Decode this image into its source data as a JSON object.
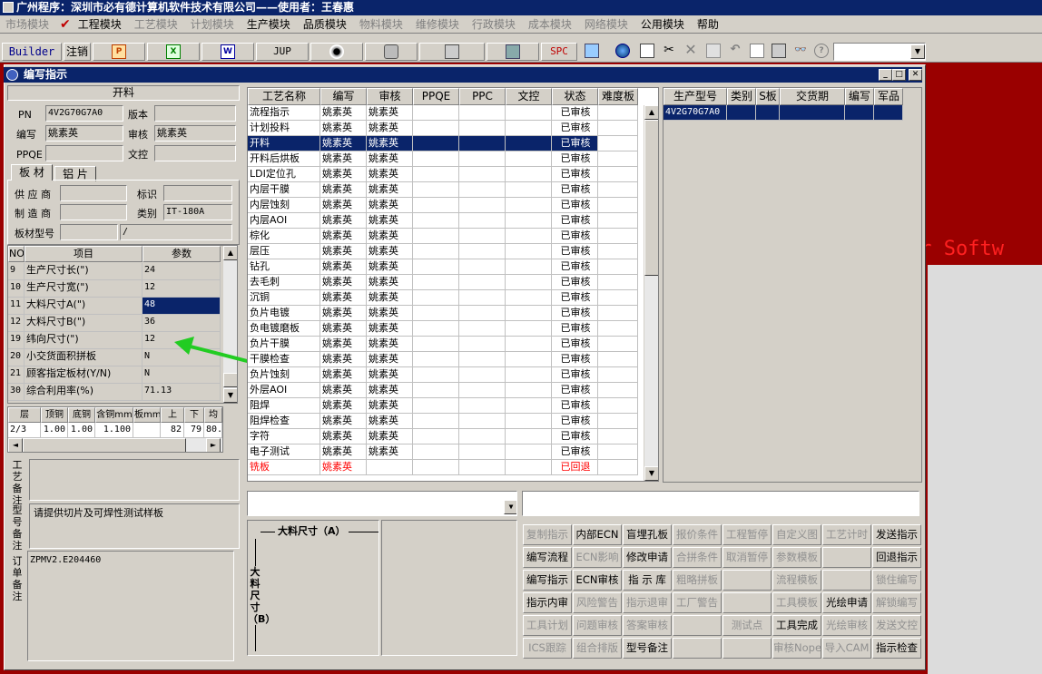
{
  "app": {
    "title": "广州程序：深圳市必有德计算机软件技术有限公司——使用者：王春惠"
  },
  "menu": [
    {
      "label": "市场模块",
      "active": false
    },
    {
      "label": "工程模块",
      "active": true
    },
    {
      "label": "工艺模块",
      "active": false
    },
    {
      "label": "计划模块",
      "active": false
    },
    {
      "label": "生产模块",
      "active": true
    },
    {
      "label": "品质模块",
      "active": true
    },
    {
      "label": "物料模块",
      "active": false
    },
    {
      "label": "维修模块",
      "active": false
    },
    {
      "label": "行政模块",
      "active": false
    },
    {
      "label": "成本模块",
      "active": false
    },
    {
      "label": "网络模块",
      "active": false
    },
    {
      "label": "公用模块",
      "active": true
    },
    {
      "label": "帮助",
      "active": true
    }
  ],
  "toolbar": {
    "builder": "Builder",
    "logout": "注销",
    "jup": "JUP",
    "spc": "SPC"
  },
  "window": {
    "title": "编写指示"
  },
  "header": {
    "section": "开料",
    "pn_label": "PN",
    "pn": "4V2G70G7A0",
    "version_label": "版本",
    "version": "",
    "author_label": "编写",
    "author": "姚素英",
    "reviewer_label": "审核",
    "reviewer": "姚素英",
    "ppqe_label": "PPQE",
    "ppqe": "",
    "doc_label": "文控",
    "doc": ""
  },
  "tabs": [
    "板 材",
    "铝 片"
  ],
  "board": {
    "supplier_label": "供 应 商",
    "supplier": "",
    "mark_label": "标识",
    "mark": "",
    "maker_label": "制 造 商",
    "maker": "",
    "category_label": "类别",
    "category": "IT-180A",
    "model_label": "板材型号",
    "model": "",
    "model2": "/"
  },
  "params": {
    "headers": [
      "NO",
      "项目",
      "参数"
    ],
    "rows": [
      {
        "no": "9",
        "item": "生产尺寸长(\")",
        "value": "24",
        "selected": false
      },
      {
        "no": "10",
        "item": "生产尺寸宽(\")",
        "value": "12",
        "selected": false
      },
      {
        "no": "11",
        "item": "大料尺寸A(\")",
        "value": "48",
        "selected": true
      },
      {
        "no": "12",
        "item": "大料尺寸B(\")",
        "value": "36",
        "selected": false
      },
      {
        "no": "19",
        "item": "纬向尺寸(\")",
        "value": "12",
        "selected": false
      },
      {
        "no": "20",
        "item": "小交货面积拼板",
        "value": "N",
        "selected": false
      },
      {
        "no": "21",
        "item": "顾客指定板材(Y/N)",
        "value": "N",
        "selected": false
      },
      {
        "no": "30",
        "item": "综合利用率(%)",
        "value": "71.13",
        "selected": false
      }
    ]
  },
  "layers": {
    "headers": [
      "层",
      "顶铜",
      "底铜",
      "含铜mm",
      "板mm",
      "上",
      "下",
      "均"
    ],
    "rows": [
      [
        "2/3",
        "1.00",
        "1.00",
        "1.100",
        "",
        "82",
        "79",
        "80."
      ]
    ]
  },
  "remarks": {
    "process_label": "工艺备注",
    "process": "",
    "model_label": "型号备注",
    "model": "请提供切片及可焊性测试样板",
    "order_label": "订单备注",
    "order": "ZPMV2.E204460"
  },
  "process": {
    "headers": [
      "工艺名称",
      "编写",
      "审核",
      "PPQE",
      "PPC",
      "文控",
      "状态",
      "难度板"
    ],
    "rows": [
      {
        "name": "流程指示",
        "author": "姚素英",
        "reviewer": "姚素英",
        "status": "已审核",
        "style": ""
      },
      {
        "name": "计划投料",
        "author": "姚素英",
        "reviewer": "姚素英",
        "status": "已审核",
        "style": ""
      },
      {
        "name": "开料",
        "author": "姚素英",
        "reviewer": "姚素英",
        "status": "已审核",
        "style": "sel"
      },
      {
        "name": "开料后烘板",
        "author": "姚素英",
        "reviewer": "姚素英",
        "status": "已审核",
        "style": ""
      },
      {
        "name": "LDI定位孔",
        "author": "姚素英",
        "reviewer": "姚素英",
        "status": "已审核",
        "style": ""
      },
      {
        "name": "内层干膜",
        "author": "姚素英",
        "reviewer": "姚素英",
        "status": "已审核",
        "style": ""
      },
      {
        "name": "内层蚀刻",
        "author": "姚素英",
        "reviewer": "姚素英",
        "status": "已审核",
        "style": ""
      },
      {
        "name": "内层AOI",
        "author": "姚素英",
        "reviewer": "姚素英",
        "status": "已审核",
        "style": ""
      },
      {
        "name": "棕化",
        "author": "姚素英",
        "reviewer": "姚素英",
        "status": "已审核",
        "style": ""
      },
      {
        "name": "层压",
        "author": "姚素英",
        "reviewer": "姚素英",
        "status": "已审核",
        "style": ""
      },
      {
        "name": "钻孔",
        "author": "姚素英",
        "reviewer": "姚素英",
        "status": "已审核",
        "style": ""
      },
      {
        "name": "去毛刺",
        "author": "姚素英",
        "reviewer": "姚素英",
        "status": "已审核",
        "style": ""
      },
      {
        "name": "沉铜",
        "author": "姚素英",
        "reviewer": "姚素英",
        "status": "已审核",
        "style": ""
      },
      {
        "name": "负片电镀",
        "author": "姚素英",
        "reviewer": "姚素英",
        "status": "已审核",
        "style": ""
      },
      {
        "name": "负电镀磨板",
        "author": "姚素英",
        "reviewer": "姚素英",
        "status": "已审核",
        "style": ""
      },
      {
        "name": "负片干膜",
        "author": "姚素英",
        "reviewer": "姚素英",
        "status": "已审核",
        "style": ""
      },
      {
        "name": "干膜检查",
        "author": "姚素英",
        "reviewer": "姚素英",
        "status": "已审核",
        "style": ""
      },
      {
        "name": "负片蚀刻",
        "author": "姚素英",
        "reviewer": "姚素英",
        "status": "已审核",
        "style": ""
      },
      {
        "name": "外层AOI",
        "author": "姚素英",
        "reviewer": "姚素英",
        "status": "已审核",
        "style": ""
      },
      {
        "name": "阻焊",
        "author": "姚素英",
        "reviewer": "姚素英",
        "status": "已审核",
        "style": ""
      },
      {
        "name": "阻焊检查",
        "author": "姚素英",
        "reviewer": "姚素英",
        "status": "已审核",
        "style": ""
      },
      {
        "name": "字符",
        "author": "姚素英",
        "reviewer": "姚素英",
        "status": "已审核",
        "style": ""
      },
      {
        "name": "电子测试",
        "author": "姚素英",
        "reviewer": "姚素英",
        "status": "已审核",
        "style": ""
      },
      {
        "name": "铣板",
        "author": "姚素英",
        "reviewer": "",
        "status": "已回退",
        "style": "red"
      }
    ]
  },
  "product": {
    "headers": [
      "生产型号",
      "类别",
      "S板",
      "交货期",
      "编写",
      "军品"
    ],
    "rows": [
      [
        "4V2G70G7A0",
        "",
        "",
        "",
        "",
        ""
      ]
    ]
  },
  "diagram": {
    "a_label": "大料尺寸（A）",
    "b_label": "大料尺寸（B）"
  },
  "actions": [
    [
      {
        "t": "复制指示",
        "e": false
      },
      {
        "t": "内部ECN",
        "e": true
      },
      {
        "t": "盲埋孔板",
        "e": true
      },
      {
        "t": "报价条件",
        "e": false
      },
      {
        "t": "工程暂停",
        "e": false
      },
      {
        "t": "自定义图",
        "e": false
      },
      {
        "t": "工艺计时",
        "e": false
      },
      {
        "t": "发送指示",
        "e": true
      }
    ],
    [
      {
        "t": "编写流程",
        "e": true
      },
      {
        "t": "ECN影响",
        "e": false
      },
      {
        "t": "修改申请",
        "e": true
      },
      {
        "t": "合拼条件",
        "e": false
      },
      {
        "t": "取消暂停",
        "e": false
      },
      {
        "t": "参数模板",
        "e": false
      },
      {
        "t": "",
        "e": false
      },
      {
        "t": "回退指示",
        "e": true
      }
    ],
    [
      {
        "t": "编写指示",
        "e": true
      },
      {
        "t": "ECN审核",
        "e": true
      },
      {
        "t": "指 示 库",
        "e": true
      },
      {
        "t": "粗略拼板",
        "e": false
      },
      {
        "t": "",
        "e": false
      },
      {
        "t": "流程模板",
        "e": false
      },
      {
        "t": "",
        "e": false
      },
      {
        "t": "锁住编写",
        "e": false
      }
    ],
    [
      {
        "t": "指示内审",
        "e": true
      },
      {
        "t": "风险警告",
        "e": false
      },
      {
        "t": "指示退审",
        "e": false
      },
      {
        "t": "工厂警告",
        "e": false
      },
      {
        "t": "",
        "e": false
      },
      {
        "t": "工具模板",
        "e": false
      },
      {
        "t": "光绘申请",
        "e": true
      },
      {
        "t": "解锁编写",
        "e": false
      }
    ],
    [
      {
        "t": "工具计划",
        "e": false
      },
      {
        "t": "问题审核",
        "e": false
      },
      {
        "t": "答案审核",
        "e": false
      },
      {
        "t": "",
        "e": false
      },
      {
        "t": "测试点",
        "e": false
      },
      {
        "t": "工具完成",
        "e": true
      },
      {
        "t": "光绘审核",
        "e": false
      },
      {
        "t": "发送文控",
        "e": false
      }
    ],
    [
      {
        "t": "ICS跟踪",
        "e": false
      },
      {
        "t": "组合排版",
        "e": false
      },
      {
        "t": "型号备注",
        "e": true
      },
      {
        "t": "",
        "e": false
      },
      {
        "t": "",
        "e": false
      },
      {
        "t": "审核Nope",
        "e": false
      },
      {
        "t": "导入CAM",
        "e": false
      },
      {
        "t": "指示检查",
        "e": true
      }
    ]
  ],
  "background": {
    "text": "er Softw"
  },
  "colors": {
    "titlebar": "#0a246a",
    "face": "#d4d0c8",
    "desktop": "#9a0000",
    "arrow": "#22cc22"
  }
}
